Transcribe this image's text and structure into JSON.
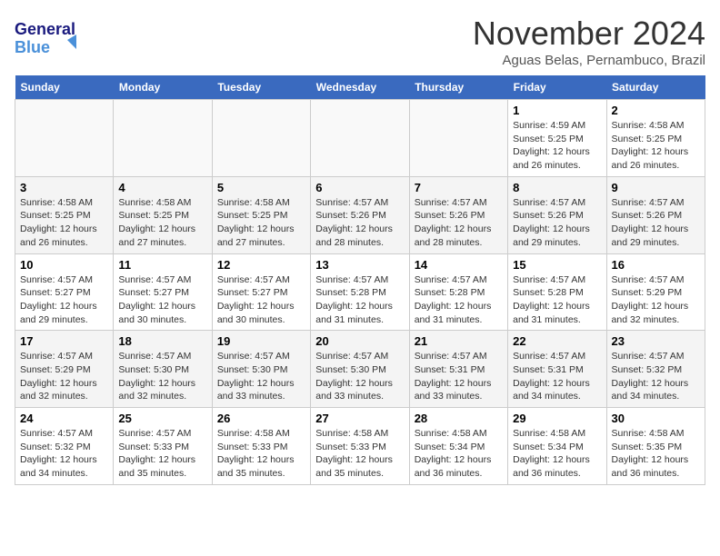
{
  "header": {
    "logo_line1": "General",
    "logo_line2": "Blue",
    "month": "November 2024",
    "location": "Aguas Belas, Pernambuco, Brazil"
  },
  "weekdays": [
    "Sunday",
    "Monday",
    "Tuesday",
    "Wednesday",
    "Thursday",
    "Friday",
    "Saturday"
  ],
  "weeks": [
    [
      {
        "day": "",
        "info": ""
      },
      {
        "day": "",
        "info": ""
      },
      {
        "day": "",
        "info": ""
      },
      {
        "day": "",
        "info": ""
      },
      {
        "day": "",
        "info": ""
      },
      {
        "day": "1",
        "info": "Sunrise: 4:59 AM\nSunset: 5:25 PM\nDaylight: 12 hours\nand 26 minutes."
      },
      {
        "day": "2",
        "info": "Sunrise: 4:58 AM\nSunset: 5:25 PM\nDaylight: 12 hours\nand 26 minutes."
      }
    ],
    [
      {
        "day": "3",
        "info": "Sunrise: 4:58 AM\nSunset: 5:25 PM\nDaylight: 12 hours\nand 26 minutes."
      },
      {
        "day": "4",
        "info": "Sunrise: 4:58 AM\nSunset: 5:25 PM\nDaylight: 12 hours\nand 27 minutes."
      },
      {
        "day": "5",
        "info": "Sunrise: 4:58 AM\nSunset: 5:25 PM\nDaylight: 12 hours\nand 27 minutes."
      },
      {
        "day": "6",
        "info": "Sunrise: 4:57 AM\nSunset: 5:26 PM\nDaylight: 12 hours\nand 28 minutes."
      },
      {
        "day": "7",
        "info": "Sunrise: 4:57 AM\nSunset: 5:26 PM\nDaylight: 12 hours\nand 28 minutes."
      },
      {
        "day": "8",
        "info": "Sunrise: 4:57 AM\nSunset: 5:26 PM\nDaylight: 12 hours\nand 29 minutes."
      },
      {
        "day": "9",
        "info": "Sunrise: 4:57 AM\nSunset: 5:26 PM\nDaylight: 12 hours\nand 29 minutes."
      }
    ],
    [
      {
        "day": "10",
        "info": "Sunrise: 4:57 AM\nSunset: 5:27 PM\nDaylight: 12 hours\nand 29 minutes."
      },
      {
        "day": "11",
        "info": "Sunrise: 4:57 AM\nSunset: 5:27 PM\nDaylight: 12 hours\nand 30 minutes."
      },
      {
        "day": "12",
        "info": "Sunrise: 4:57 AM\nSunset: 5:27 PM\nDaylight: 12 hours\nand 30 minutes."
      },
      {
        "day": "13",
        "info": "Sunrise: 4:57 AM\nSunset: 5:28 PM\nDaylight: 12 hours\nand 31 minutes."
      },
      {
        "day": "14",
        "info": "Sunrise: 4:57 AM\nSunset: 5:28 PM\nDaylight: 12 hours\nand 31 minutes."
      },
      {
        "day": "15",
        "info": "Sunrise: 4:57 AM\nSunset: 5:28 PM\nDaylight: 12 hours\nand 31 minutes."
      },
      {
        "day": "16",
        "info": "Sunrise: 4:57 AM\nSunset: 5:29 PM\nDaylight: 12 hours\nand 32 minutes."
      }
    ],
    [
      {
        "day": "17",
        "info": "Sunrise: 4:57 AM\nSunset: 5:29 PM\nDaylight: 12 hours\nand 32 minutes."
      },
      {
        "day": "18",
        "info": "Sunrise: 4:57 AM\nSunset: 5:30 PM\nDaylight: 12 hours\nand 32 minutes."
      },
      {
        "day": "19",
        "info": "Sunrise: 4:57 AM\nSunset: 5:30 PM\nDaylight: 12 hours\nand 33 minutes."
      },
      {
        "day": "20",
        "info": "Sunrise: 4:57 AM\nSunset: 5:30 PM\nDaylight: 12 hours\nand 33 minutes."
      },
      {
        "day": "21",
        "info": "Sunrise: 4:57 AM\nSunset: 5:31 PM\nDaylight: 12 hours\nand 33 minutes."
      },
      {
        "day": "22",
        "info": "Sunrise: 4:57 AM\nSunset: 5:31 PM\nDaylight: 12 hours\nand 34 minutes."
      },
      {
        "day": "23",
        "info": "Sunrise: 4:57 AM\nSunset: 5:32 PM\nDaylight: 12 hours\nand 34 minutes."
      }
    ],
    [
      {
        "day": "24",
        "info": "Sunrise: 4:57 AM\nSunset: 5:32 PM\nDaylight: 12 hours\nand 34 minutes."
      },
      {
        "day": "25",
        "info": "Sunrise: 4:57 AM\nSunset: 5:33 PM\nDaylight: 12 hours\nand 35 minutes."
      },
      {
        "day": "26",
        "info": "Sunrise: 4:58 AM\nSunset: 5:33 PM\nDaylight: 12 hours\nand 35 minutes."
      },
      {
        "day": "27",
        "info": "Sunrise: 4:58 AM\nSunset: 5:33 PM\nDaylight: 12 hours\nand 35 minutes."
      },
      {
        "day": "28",
        "info": "Sunrise: 4:58 AM\nSunset: 5:34 PM\nDaylight: 12 hours\nand 36 minutes."
      },
      {
        "day": "29",
        "info": "Sunrise: 4:58 AM\nSunset: 5:34 PM\nDaylight: 12 hours\nand 36 minutes."
      },
      {
        "day": "30",
        "info": "Sunrise: 4:58 AM\nSunset: 5:35 PM\nDaylight: 12 hours\nand 36 minutes."
      }
    ]
  ]
}
